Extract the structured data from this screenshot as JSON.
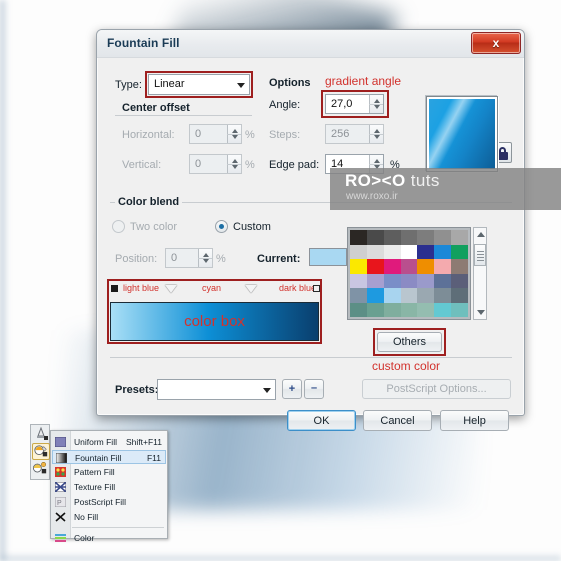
{
  "background": {
    "description": "blurred dark blue diagonal artwork on white canvas"
  },
  "dialog": {
    "title": "Fountain Fill",
    "close_label": "x",
    "type_section": {
      "type_label": "Type:",
      "type_value": "Linear",
      "center_offset_label": "Center offset",
      "horizontal_label": "Horizontal:",
      "horizontal_value": "0",
      "horizontal_unit": "%",
      "vertical_label": "Vertical:",
      "vertical_value": "0",
      "vertical_unit": "%"
    },
    "options_section": {
      "title": "Options",
      "angle_label": "Angle:",
      "angle_value": "27,0",
      "steps_label": "Steps:",
      "steps_value": "256",
      "steps_lock_icon": "lock-icon",
      "edge_pad_label": "Edge pad:",
      "edge_pad_value": "14",
      "edge_pad_unit": "%"
    },
    "color_blend": {
      "title": "Color blend",
      "two_color_label": "Two color",
      "custom_label": "Custom",
      "custom_selected": true,
      "position_label": "Position:",
      "position_value": "0",
      "position_unit": "%",
      "current_label": "Current:",
      "current_swatch": "#a9d8f2",
      "stops": [
        {
          "label": "light blue",
          "color": "#a9dff6",
          "position": 0
        },
        {
          "label": "cyan",
          "color": "#0d8fd6",
          "position": 47
        },
        {
          "label": "dark blue",
          "color": "#0a3f6e",
          "position": 100
        }
      ],
      "band_annotation": "color box"
    },
    "palette": {
      "others_label": "Others",
      "colors": [
        "#2b2724",
        "#4a4a4a",
        "#5e5e5e",
        "#6f6f6f",
        "#7d7d7d",
        "#909090",
        "#a8a8a8",
        "#cfcfcf",
        "#dcdcdc",
        "#ececec",
        "#ffffff",
        "#2b2f8f",
        "#1b88d8",
        "#11a05e",
        "#fbe800",
        "#e8151c",
        "#e01a7c",
        "#b94f8e",
        "#ef8e00",
        "#f4aaae",
        "#8d7b73",
        "#c9c6e2",
        "#a79fd0",
        "#7a8ec8",
        "#8b8bc4",
        "#9a9acb",
        "#5d7198",
        "#5b5f79",
        "#7f93a6",
        "#1e9ae0",
        "#a8d4ef",
        "#b9c6cf",
        "#9aa8b1",
        "#7d8d97",
        "#5e6e78",
        "#5c8f86",
        "#6aa091",
        "#7fae9e",
        "#89b6a6",
        "#94bdb0",
        "#63c9d2",
        "#6fbfbd"
      ],
      "scroll_up_icon": "scroll-up-icon",
      "scroll_down_icon": "scroll-down-icon"
    },
    "footer": {
      "presets_label": "Presets:",
      "presets_value": "",
      "add_preset_icon": "plus-icon",
      "remove_preset_icon": "minus-icon",
      "postscript_label": "PostScript Options...",
      "ok_label": "OK",
      "cancel_label": "Cancel",
      "help_label": "Help"
    }
  },
  "annotations": {
    "gradient_angle": "gradient angle",
    "custom_color": "custom color"
  },
  "watermark": {
    "brand_bold": "RO><O",
    "brand_light": "tuts",
    "url": "www.roxo.ir"
  },
  "flyout_menu": {
    "items": [
      {
        "label": "Uniform Fill",
        "shortcut": "Shift+F11",
        "icon": "uniform-fill-icon",
        "highlighted": false
      },
      {
        "label": "Fountain Fill",
        "shortcut": "F11",
        "icon": "fountain-fill-icon",
        "highlighted": true
      },
      {
        "label": "Pattern Fill",
        "shortcut": "",
        "icon": "pattern-fill-icon",
        "highlighted": false
      },
      {
        "label": "Texture Fill",
        "shortcut": "",
        "icon": "texture-fill-icon",
        "highlighted": false
      },
      {
        "label": "PostScript Fill",
        "shortcut": "",
        "icon": "postscript-fill-icon",
        "highlighted": false
      },
      {
        "label": "No Fill",
        "shortcut": "",
        "icon": "no-fill-icon",
        "highlighted": false
      },
      {
        "label": "Color",
        "shortcut": "",
        "icon": "color-docker-icon",
        "highlighted": false
      }
    ],
    "toolbar_icons": [
      "outline-pen-icon",
      "fill-tool-icon",
      "interactive-fill-icon"
    ]
  }
}
